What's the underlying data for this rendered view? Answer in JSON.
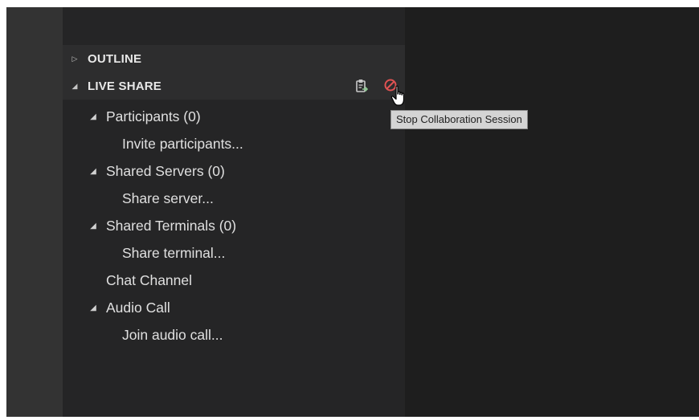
{
  "sidebar": {
    "sections": {
      "outline": {
        "label": "OUTLINE",
        "twisty": "collapsed"
      },
      "live_share": {
        "label": "LIVE SHARE",
        "twisty": "expanded",
        "actions": [
          {
            "name": "copy-link-icon",
            "color": "#8dc891"
          },
          {
            "name": "stop-session-icon",
            "color": "#e05252"
          }
        ]
      }
    },
    "tree": {
      "participants": {
        "label": "Participants (0)",
        "child": "Invite participants..."
      },
      "shared_servers": {
        "label": "Shared Servers (0)",
        "child": "Share server..."
      },
      "shared_terminals": {
        "label": "Shared Terminals (0)",
        "child": "Share terminal..."
      },
      "chat_channel": {
        "label": "Chat Channel"
      },
      "audio_call": {
        "label": "Audio Call",
        "child": "Join audio call..."
      }
    }
  },
  "tooltip": {
    "text": "Stop Collaboration Session"
  },
  "cursor": {
    "type": "hand-pointer"
  },
  "colors": {
    "sidebar_bg": "#252526",
    "editor_bg": "#1e1e1e",
    "activity_bar_bg": "#333333",
    "text": "#e0e0e0",
    "stop_icon": "#e05252"
  }
}
